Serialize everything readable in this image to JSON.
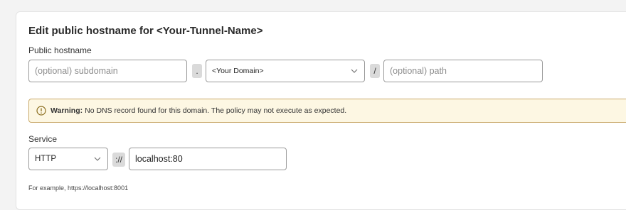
{
  "form": {
    "title": "Edit public hostname for <Your-Tunnel-Name>",
    "public_hostname_label": "Public hostname",
    "subdomain_placeholder": "(optional) subdomain",
    "dot_separator": ".",
    "domain_select_value": "<Your Domain>",
    "slash_separator": "/",
    "path_placeholder": "(optional) path",
    "warning": {
      "title": "Warning:",
      "message": "No DNS record found for this domain. The policy may not execute as expected.",
      "icon": "warning-circle-icon",
      "background": "#fdf7e3",
      "border": "#c9a96a"
    },
    "service_label": "Service",
    "service_type_value": "HTTP",
    "scheme_separator": "://",
    "service_url_value": "localhost:80",
    "hint": "For example, https://localhost:8001"
  }
}
